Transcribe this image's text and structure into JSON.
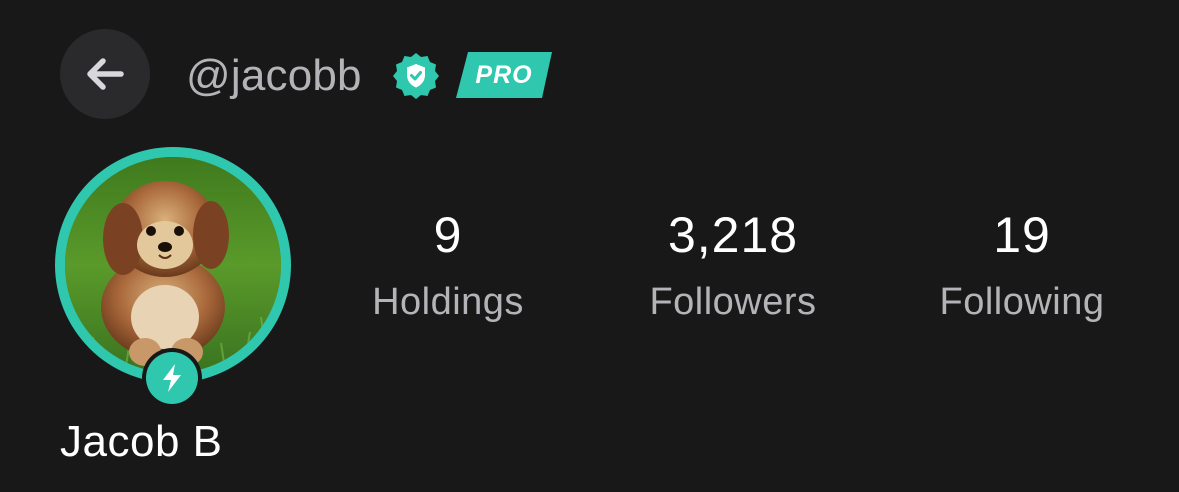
{
  "header": {
    "back_icon": "arrow-left-icon",
    "handle": "@jacobb",
    "verified_icon": "verified-badge-icon",
    "pro_label": "PRO"
  },
  "profile": {
    "display_name": "Jacob B",
    "avatar_description_icon": "avatar-puppy-photo",
    "avatar_badge_icon": "lightning-bolt-icon"
  },
  "stats": [
    {
      "value": "9",
      "label": "Holdings"
    },
    {
      "value": "3,218",
      "label": "Followers"
    },
    {
      "value": "19",
      "label": "Following"
    }
  ],
  "colors": {
    "background": "#181818",
    "accent": "#2fc7ae",
    "muted_text": "#b4b4b8",
    "button_bg": "#2a2a2c"
  }
}
